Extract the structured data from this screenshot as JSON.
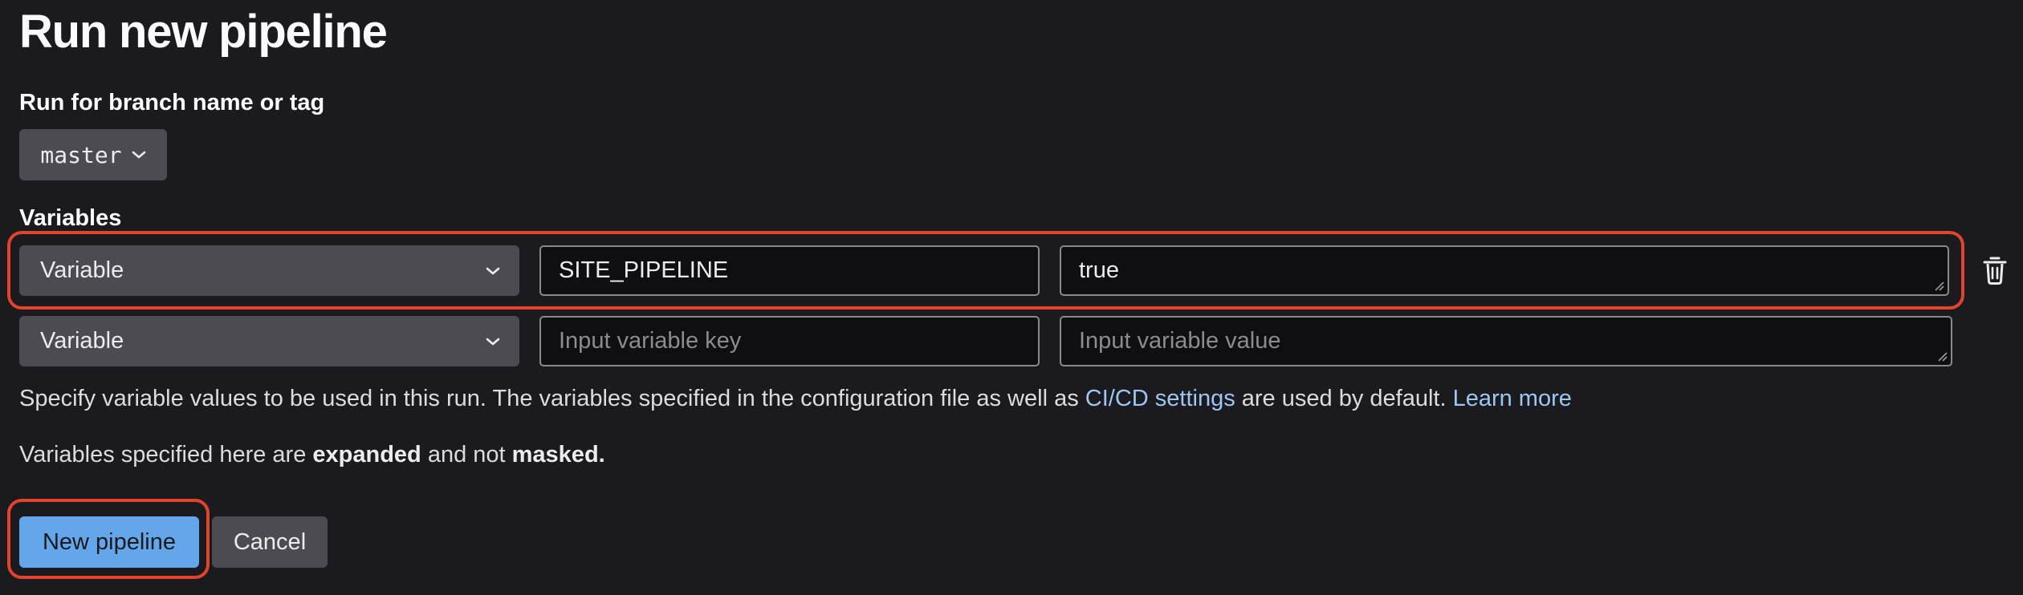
{
  "page": {
    "title": "Run new pipeline"
  },
  "branch": {
    "label": "Run for branch name or tag",
    "value": "master",
    "icon": "chevron-down-icon"
  },
  "variables": {
    "label": "Variables",
    "rows": [
      {
        "type": "Variable",
        "key": "SITE_PIPELINE",
        "value": "true"
      },
      {
        "type": "Variable",
        "key": "",
        "value": ""
      }
    ],
    "key_placeholder": "Input variable key",
    "value_placeholder": "Input variable value",
    "remove_icon": "trash-icon"
  },
  "help": {
    "text_1": "Specify variable values to be used in this run. The variables specified in the configuration file as well as ",
    "link_cicd": "CI/CD settings",
    "text_2": " are used by default. ",
    "link_learn": "Learn more",
    "note_1": "Variables specified here are ",
    "note_bold_1": "expanded",
    "note_2": " and not ",
    "note_bold_2": "masked."
  },
  "actions": {
    "submit_label": "New pipeline",
    "cancel_label": "Cancel"
  },
  "colors": {
    "background": "#1a1a1f",
    "primary_button": "#63a6e9",
    "link": "#9dc7f1",
    "highlight": "#e0442a"
  }
}
